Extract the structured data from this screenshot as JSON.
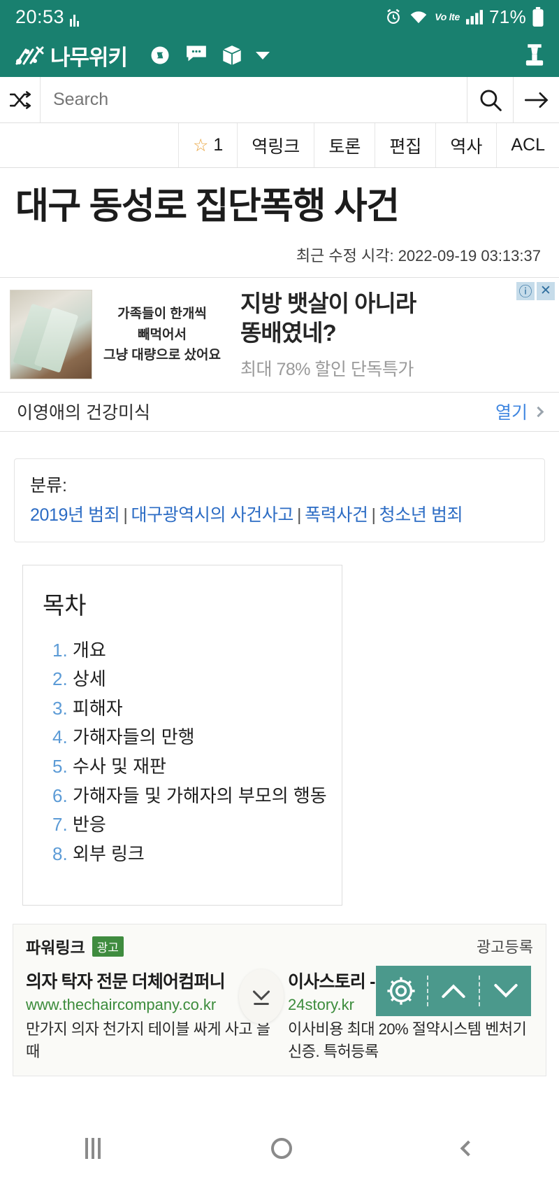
{
  "statusbar": {
    "time": "20:53",
    "battery": "71%",
    "network_label": "Vo lte",
    "icons": [
      "signal-bars-icon",
      "alarm-icon",
      "wifi-icon",
      "volte-icon",
      "cellular-icon",
      "battery-icon"
    ]
  },
  "brand": {
    "logo_text": "나무위키",
    "icons": [
      "compass-icon",
      "chat-icon",
      "box-icon",
      "chevron-down-icon",
      "profile-icon"
    ]
  },
  "search": {
    "placeholder": "Search",
    "value": "",
    "shuffle_icon": "shuffle-icon",
    "search_icon": "search-icon",
    "go_icon": "arrow-right-icon"
  },
  "tabs": [
    {
      "label": "1",
      "icon": "star-icon"
    },
    {
      "label": "역링크"
    },
    {
      "label": "토론"
    },
    {
      "label": "편집"
    },
    {
      "label": "역사"
    },
    {
      "label": "ACL"
    }
  ],
  "article": {
    "title": "대구 동성로 집단폭행 사건",
    "edited": "최근 수정 시각: 2022-09-19 03:13:37"
  },
  "top_ad": {
    "sub_lines": [
      "가족들이 한개씩",
      "빼먹어서",
      "그냥 대량으로 샀어요"
    ],
    "headline_line1": "지방 뱃살이 아니라",
    "headline_line2": "똥배였네?",
    "description": "최대 78% 할인 단독특가",
    "info_icon": "info-icon",
    "close_icon": "close-icon",
    "advertiser": "이영애의 건강미식",
    "open_label": "열기",
    "open_chevron": "chevron-right-icon"
  },
  "categories": {
    "label": "분류:",
    "items": [
      "2019년 범죄",
      "대구광역시의 사건사고",
      "폭력사건",
      "청소년 범죄"
    ],
    "separator": "|"
  },
  "toc": {
    "title": "목차",
    "items": [
      {
        "num": "1.",
        "label": "개요"
      },
      {
        "num": "2.",
        "label": "상세"
      },
      {
        "num": "3.",
        "label": "피해자"
      },
      {
        "num": "4.",
        "label": "가해자들의 만행"
      },
      {
        "num": "5.",
        "label": "수사 및 재판"
      },
      {
        "num": "6.",
        "label": "가해자들 및 가해자의 부모의 행동"
      },
      {
        "num": "7.",
        "label": "반응"
      },
      {
        "num": "8.",
        "label": "외부 링크"
      }
    ]
  },
  "powerlink": {
    "title": "파워링크",
    "badge": "광고",
    "register": "광고등록",
    "items": [
      {
        "title": "의자 탁자 전문 더체어컴퍼니",
        "url": "www.thechaircompany.co.kr",
        "desc": "만가지 의자 천가지 테이블 싸게 사고 을 때"
      },
      {
        "title": "이사스토리 - 포장이사 전문",
        "url": "24story.kr",
        "desc": "이사비용 최대 20% 절약시스템 벤처기 신증. 특허등록"
      }
    ]
  },
  "floating": {
    "scroll_down_icon": "chevron-down-icon",
    "gear_icon": "gear-icon",
    "up_icon": "chevron-up-icon",
    "down_icon": "chevron-down-icon"
  },
  "androidnav": {
    "recents_icon": "recents-icon",
    "home_icon": "home-icon",
    "back_icon": "back-icon"
  },
  "colors": {
    "brand_teal": "#19806f",
    "float_teal": "#4b998c",
    "link_blue": "#2c6cc4",
    "toc_blue": "#5c9bd6",
    "ad_green": "#3f8c3f"
  }
}
